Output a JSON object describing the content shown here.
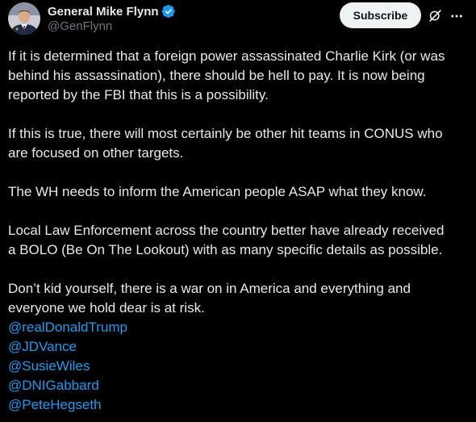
{
  "author": {
    "display_name": "General Mike Flynn",
    "handle": "@GenFlynn",
    "verified_icon": "verified-badge-icon",
    "avatar_icon": "profile-photo"
  },
  "actions": {
    "subscribe_label": "Subscribe",
    "grok_icon": "grok-icon",
    "more_icon": "more-options-icon"
  },
  "colors": {
    "background": "#000000",
    "text": "#e7e9ea",
    "secondary_text": "#71767b",
    "link": "#1d9bf0",
    "verified": "#1d9bf0",
    "button_bg": "#eff3f4"
  },
  "tweet": {
    "line_1": "If it is determined that a foreign power assassinated Charlie Kirk (or was",
    "line_2": "behind his assassination), there should be hell to pay. It is now being",
    "line_3": "reported by the FBI that this is a possibility.",
    "line_4": "If this is true, there will most certainly be other hit teams in CONUS who",
    "line_5": "are focused on other targets.",
    "line_6": "The WH needs to inform the American people ASAP what they know.",
    "line_7": "Local Law Enforcement across the country better have already received",
    "line_8": "a BOLO (Be On The Lookout) with as many specific details as possible.",
    "line_9": "Don’t kid yourself, there is a war on in America and everything and",
    "line_10": "everyone we hold dear is at risk.",
    "mentions": [
      "@realDonaldTrump",
      "@JDVance",
      "@SusieWiles",
      "@DNIGabbard",
      "@PeteHegseth"
    ]
  }
}
